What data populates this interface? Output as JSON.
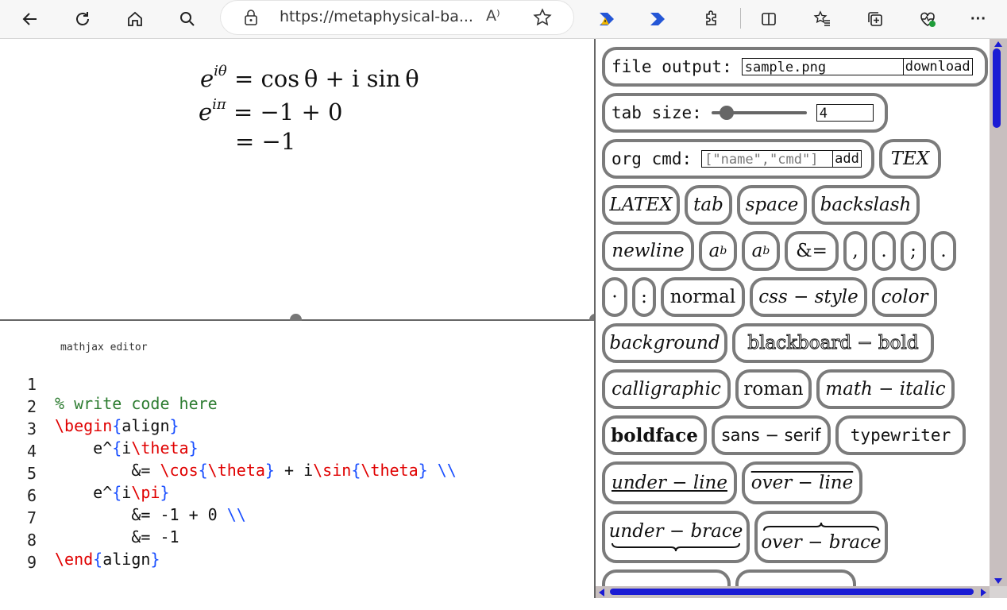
{
  "browser": {
    "url": "https://metaphysical-ba...",
    "read_aloud_glyph": "A⁾",
    "more_glyph": "···"
  },
  "preview": {
    "row1_lhs": "e",
    "row1_sup": "iθ",
    "row1_rhs": "= cos θ + i sin θ",
    "row2_lhs": "e",
    "row2_sup": "iπ",
    "row2_rhs": "= −1 + 0",
    "row3_rhs": "= −1"
  },
  "editor": {
    "label": "mathjax editor",
    "line_numbers": [
      "1",
      "2",
      "3",
      "4",
      "5",
      "6",
      "7",
      "8",
      "9"
    ]
  },
  "panel": {
    "file_output_label": "file output:",
    "file_output_value": "sample.png",
    "download_label": "download",
    "tab_size_label": "tab size:",
    "tab_size_value": "4",
    "tab_size_level": 0.1,
    "org_cmd_label": "org cmd:",
    "org_cmd_placeholder": "[\"name\",\"cmd\"]",
    "add_label": "add",
    "buttons": {
      "tex": "TEX",
      "latex": "LATEX",
      "tab": "tab",
      "space": "space",
      "backslash": "backslash",
      "newline": "newline",
      "superscript": "a",
      "superscript_exp": "b",
      "subscript": "a",
      "subscript_idx": "b",
      "align": "&=",
      "comma": ",",
      "period": ".",
      "semicolon": ";",
      "dot_big": ".",
      "cdot": "·",
      "colon": ":",
      "normal": "normal",
      "css_style": "css − style",
      "color": "color",
      "background": "background",
      "blackboard_bold": "blackboard − bold",
      "calligraphic": "calligraphic",
      "roman": "roman",
      "math_italic": "math − italic",
      "boldface": "boldface",
      "sans_serif": "sans − serif",
      "typewriter": "typewriter",
      "under_line": "under − line",
      "over_line": "over − line",
      "under_brace": "under − brace",
      "over_brace": "over − brace"
    }
  }
}
